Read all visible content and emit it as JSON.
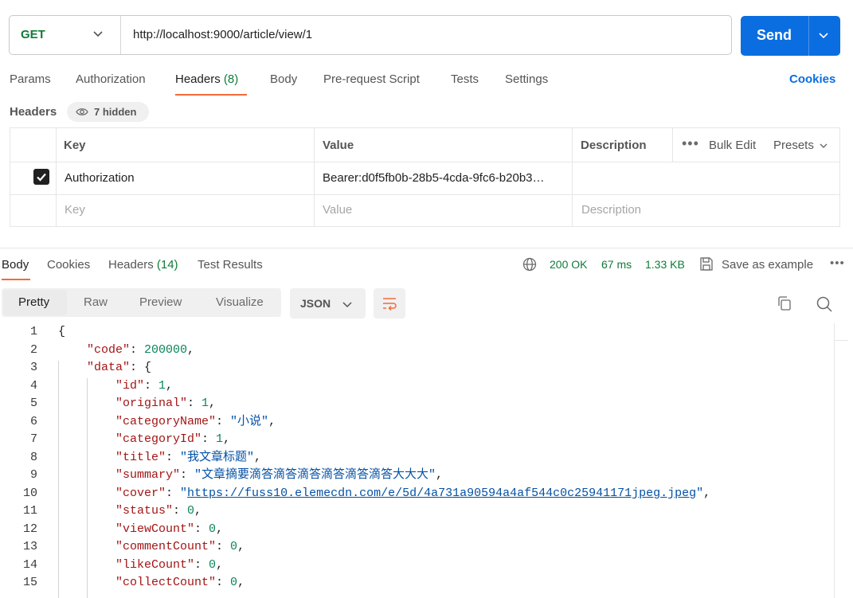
{
  "request": {
    "method": "GET",
    "url": "http://localhost:9000/article/view/1",
    "send_label": "Send"
  },
  "request_tabs": [
    {
      "label": "Params"
    },
    {
      "label": "Authorization"
    },
    {
      "label": "Headers",
      "count": "(8)"
    },
    {
      "label": "Body"
    },
    {
      "label": "Pre-request Script"
    },
    {
      "label": "Tests"
    },
    {
      "label": "Settings"
    }
  ],
  "cookies_link": "Cookies",
  "headers_section": {
    "title": "Headers",
    "hidden_badge": "7 hidden",
    "columns": {
      "key": "Key",
      "value": "Value",
      "description": "Description"
    },
    "bulk_edit": "Bulk Edit",
    "presets": "Presets",
    "rows": [
      {
        "checked": true,
        "key": "Authorization",
        "value": "Bearer:d0f5fb0b-28b5-4cda-9fc6-b20b3…",
        "description": ""
      }
    ],
    "placeholder_row": {
      "key": "Key",
      "value": "Value",
      "description": "Description"
    }
  },
  "response_tabs": [
    {
      "label": "Body"
    },
    {
      "label": "Cookies"
    },
    {
      "label": "Headers",
      "count": "(14)"
    },
    {
      "label": "Test Results"
    }
  ],
  "response_meta": {
    "status": "200 OK",
    "time": "67 ms",
    "size": "1.33 KB",
    "save_label": "Save as example"
  },
  "view_tabs": [
    "Pretty",
    "Raw",
    "Preview",
    "Visualize"
  ],
  "format": "JSON",
  "code_lines": [
    {
      "n": "1"
    },
    {
      "n": "2"
    },
    {
      "n": "3"
    },
    {
      "n": "4"
    },
    {
      "n": "5"
    },
    {
      "n": "6"
    },
    {
      "n": "7"
    },
    {
      "n": "8"
    },
    {
      "n": "9"
    },
    {
      "n": "10"
    },
    {
      "n": "11"
    },
    {
      "n": "12"
    },
    {
      "n": "13"
    },
    {
      "n": "14"
    },
    {
      "n": "15"
    }
  ],
  "json_body": {
    "code_key": "\"code\"",
    "code_val": "200000",
    "data_key": "\"data\"",
    "id_key": "\"id\"",
    "id_val": "1",
    "original_key": "\"original\"",
    "original_val": "1",
    "categoryName_key": "\"categoryName\"",
    "categoryName_val": "\"小说\"",
    "categoryId_key": "\"categoryId\"",
    "categoryId_val": "1",
    "title_key": "\"title\"",
    "title_val": "\"我文章标题\"",
    "summary_key": "\"summary\"",
    "summary_val": "\"文章摘要滴答滴答滴答滴答滴答滴答大大大\"",
    "cover_key": "\"cover\"",
    "cover_val": "https://fuss10.elemecdn.com/e/5d/4a731a90594a4af544c0c25941171jpeg.jpeg",
    "status_key": "\"status\"",
    "status_val": "0",
    "viewCount_key": "\"viewCount\"",
    "viewCount_val": "0",
    "commentCount_key": "\"commentCount\"",
    "commentCount_val": "0",
    "likeCount_key": "\"likeCount\"",
    "likeCount_val": "0",
    "collectCount_key": "\"collectCount\"",
    "collectCount_val": "0"
  },
  "colors": {
    "accent": "#0b6ee0",
    "active_tab": "#f26b3a",
    "method": "#0f7b3a",
    "status_ok": "#0f7b3a"
  }
}
